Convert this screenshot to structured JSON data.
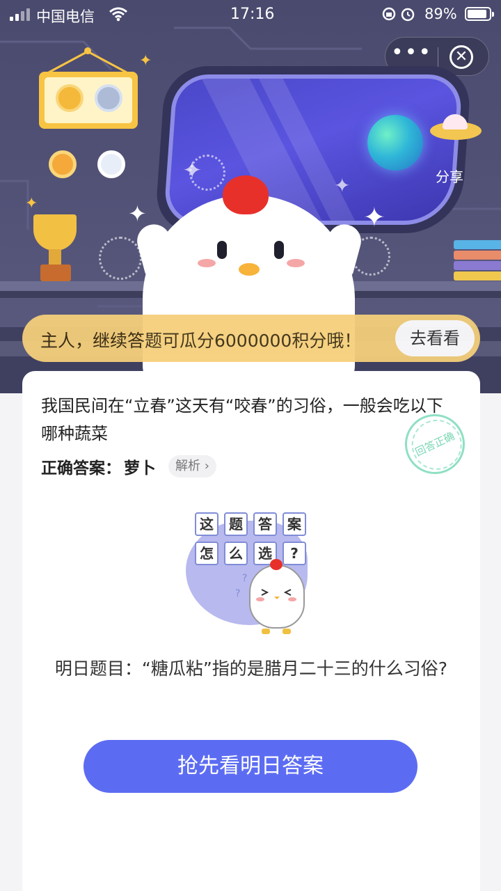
{
  "status_bar": {
    "carrier": "中国电信",
    "time": "17:16",
    "battery_percent": "89%",
    "battery_level": 0.89
  },
  "capsule": {
    "more_label": "•••",
    "close_symbol": "✕"
  },
  "scene": {
    "share_label": "分享"
  },
  "banner": {
    "text": "主人，继续答题可瓜分6000000积分哦！",
    "button_label": "去看看"
  },
  "question_card": {
    "question": "我国民间在“立春”这天有“咬春”的习俗，一般会吃以下哪种蔬菜",
    "answer_label": "正确答案：",
    "answer_value": "萝卜",
    "analysis_label": "解析 ›",
    "stamp_text": "回答正确"
  },
  "illustration": {
    "tiles": [
      "这",
      "题",
      "答",
      "案",
      "怎",
      "么",
      "选",
      "?"
    ]
  },
  "tomorrow": {
    "text": "明日题目：“糖瓜粘”指的是腊月二十三的什么习俗?"
  },
  "cta": {
    "label": "抢先看明日答案"
  },
  "colors": {
    "accent": "#5c6cf2",
    "banner": "#f5cf7a",
    "scene_bg": "#4a4a6e",
    "comb_red": "#e8302b"
  },
  "icons": [
    "signal-icon",
    "wifi-icon",
    "lock-rotation-icon",
    "alarm-icon",
    "battery-icon",
    "more-icon",
    "close-icon",
    "planet-icon",
    "ufo-icon",
    "trophy-icon",
    "medal-icon",
    "chevron-right-icon"
  ]
}
